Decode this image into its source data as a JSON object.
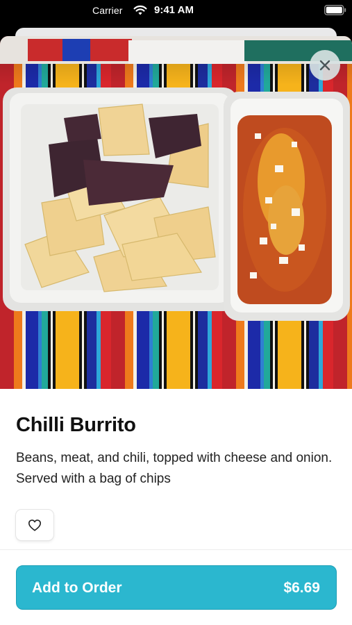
{
  "status_bar": {
    "carrier": "Carrier",
    "time": "9:41 AM",
    "icons": [
      "wifi-icon",
      "battery-icon"
    ]
  },
  "item": {
    "photo_alt": "Chilli Burrito photo",
    "title": "Chilli Burrito",
    "description": "Beans, meat, and chili, topped with cheese and onion. Served with a bag of chips"
  },
  "actions": {
    "close_icon": "close-icon",
    "favorite_icon": "heart-outline-icon",
    "add_label": "Add to Order",
    "price": "$6.69"
  },
  "colors": {
    "accent": "#2bb7cf",
    "text_primary": "#111111",
    "close_bg": "#d7e2e2"
  }
}
